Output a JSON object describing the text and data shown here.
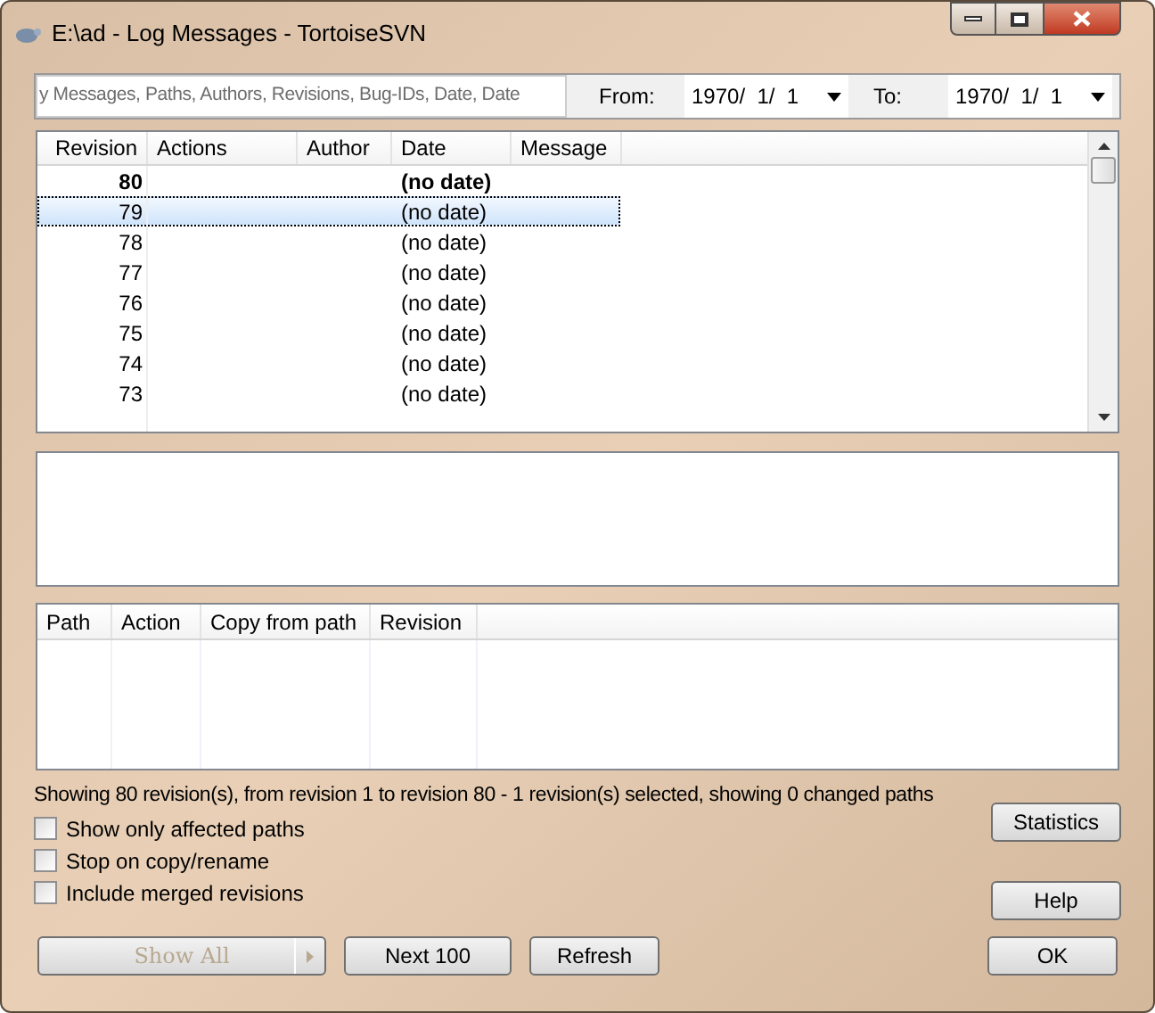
{
  "window": {
    "title": "E:\\ad - Log Messages - TortoiseSVN"
  },
  "filter": {
    "placeholder": "y Messages, Paths, Authors, Revisions, Bug-IDs, Date, Date",
    "from_label": "From:",
    "from_value": "1970/  1/  1",
    "to_label": "To:",
    "to_value": "1970/  1/  1"
  },
  "log_table": {
    "columns": [
      "Revision",
      "Actions",
      "Author",
      "Date",
      "Message"
    ],
    "rows": [
      {
        "revision": "80",
        "date": "(no date)",
        "bold": true,
        "selected": false
      },
      {
        "revision": "79",
        "date": "(no date)",
        "bold": false,
        "selected": true
      },
      {
        "revision": "78",
        "date": "(no date)",
        "bold": false,
        "selected": false
      },
      {
        "revision": "77",
        "date": "(no date)",
        "bold": false,
        "selected": false
      },
      {
        "revision": "76",
        "date": "(no date)",
        "bold": false,
        "selected": false
      },
      {
        "revision": "75",
        "date": "(no date)",
        "bold": false,
        "selected": false
      },
      {
        "revision": "74",
        "date": "(no date)",
        "bold": false,
        "selected": false
      },
      {
        "revision": "73",
        "date": "(no date)",
        "bold": false,
        "selected": false
      }
    ]
  },
  "paths_table": {
    "columns": [
      "Path",
      "Action",
      "Copy from path",
      "Revision"
    ]
  },
  "status_bar": "Showing 80 revision(s), from revision 1 to revision 80 - 1 revision(s) selected, showing 0 changed paths",
  "options": [
    {
      "label": "Show only affected paths",
      "checked": false
    },
    {
      "label": "Stop on copy/rename",
      "checked": false
    },
    {
      "label": "Include merged revisions",
      "checked": false
    }
  ],
  "side_buttons": [
    {
      "label": "Statistics",
      "disabled": false
    },
    {
      "label": "Help",
      "disabled": false
    }
  ],
  "bottom_buttons": [
    {
      "label": "Show All",
      "disabled": true,
      "kind": "split"
    },
    {
      "label": "Next 100",
      "disabled": false,
      "kind": "plain"
    },
    {
      "label": "Refresh",
      "disabled": false,
      "kind": "plain"
    }
  ],
  "ok_button": {
    "label": "OK",
    "disabled": false
  }
}
